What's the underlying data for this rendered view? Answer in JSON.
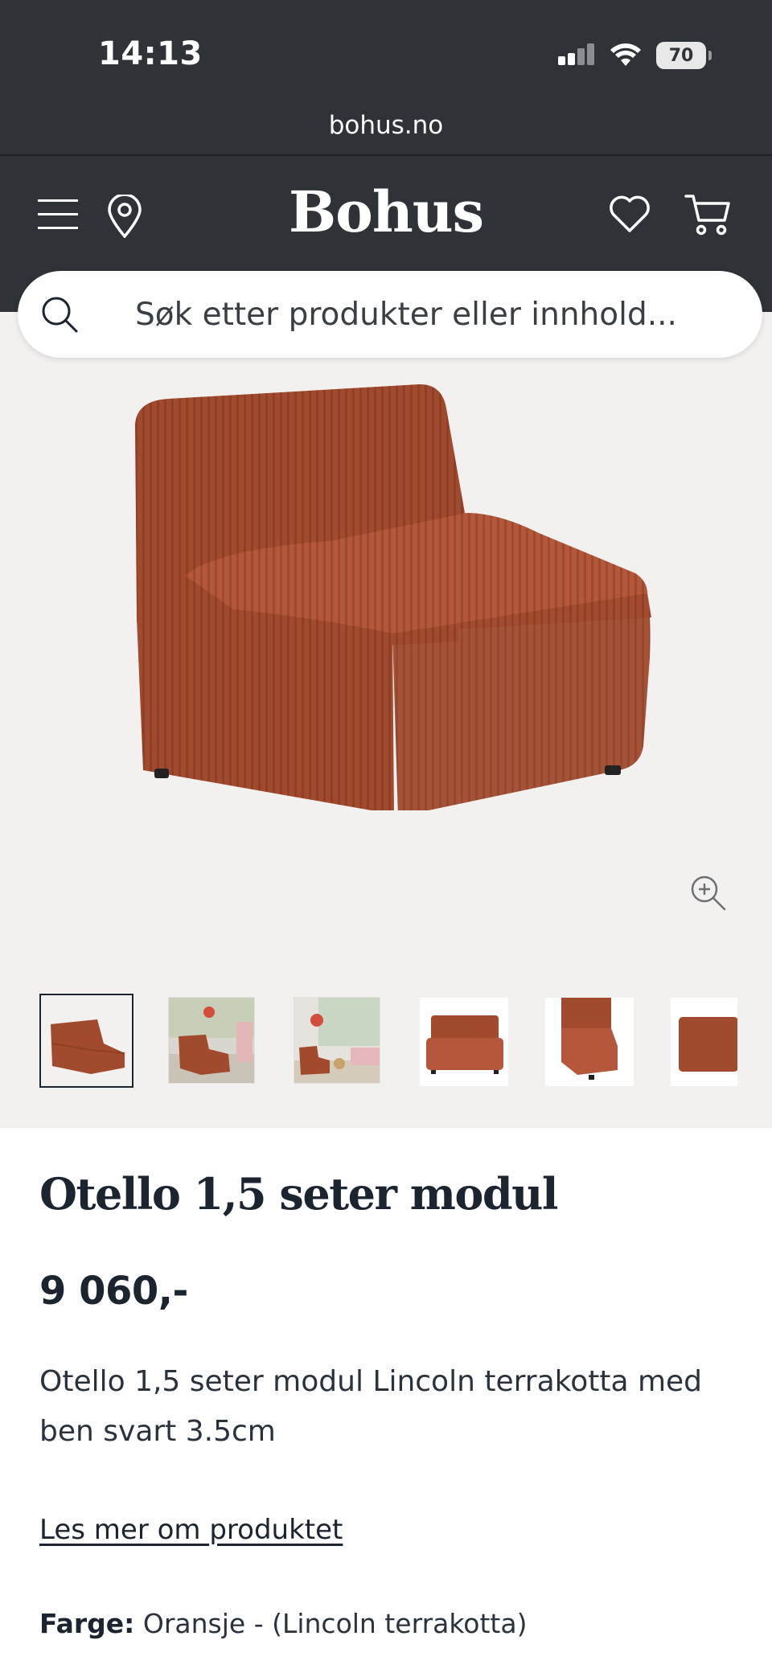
{
  "status_bar": {
    "time": "14:13",
    "battery": "70"
  },
  "browser": {
    "url": "bohus.no"
  },
  "header": {
    "logo": "Bohus"
  },
  "search": {
    "placeholder": "Søk etter produkter eller innhold..."
  },
  "gallery": {
    "thumbnail_count": 6,
    "active_thumbnail": 1
  },
  "product": {
    "title": "Otello 1,5 seter modul",
    "price": "9 060,-",
    "description": "Otello 1,5 seter modul Lincoln terrakotta med ben svart 3.5cm",
    "read_more": "Les mer om produktet",
    "color_label": "Farge:",
    "color_value": "Oransje - (Lincoln terrakotta)"
  },
  "colors": {
    "dark_header": "#2f3236",
    "gallery_bg": "#f3f1f0",
    "fabric": "#a04a2e",
    "text": "#1c2430"
  }
}
